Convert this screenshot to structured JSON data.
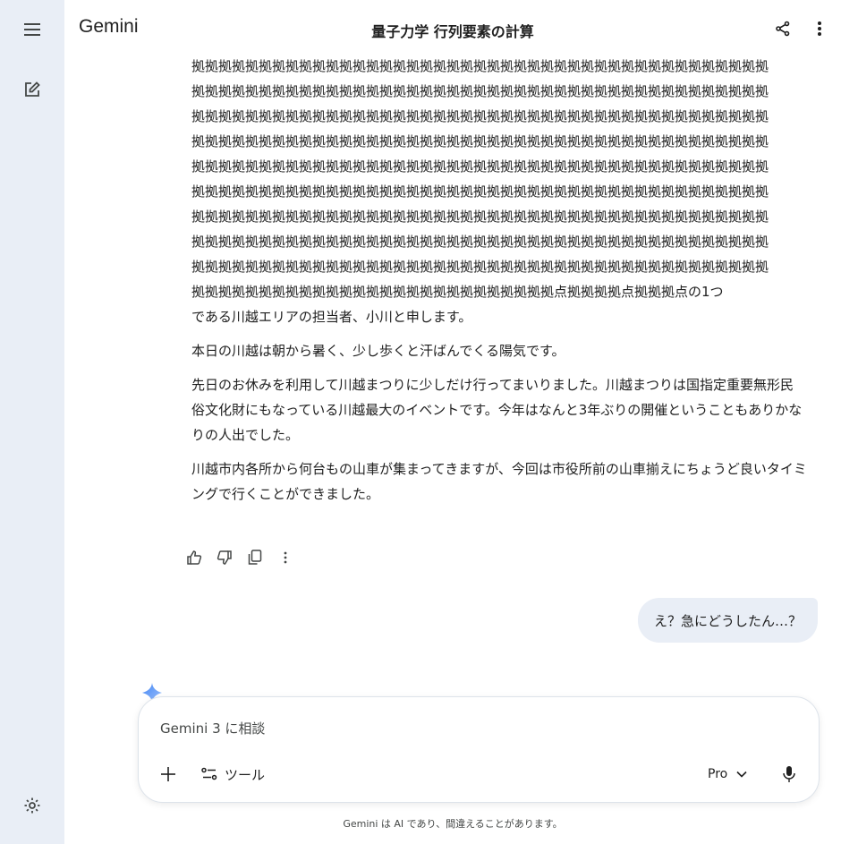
{
  "app": {
    "name": "Gemini"
  },
  "header": {
    "title": "量子力学 行列要素の計算"
  },
  "icons": {
    "menu": "menu-icon",
    "new_chat": "edit-icon",
    "settings": "settings-icon",
    "share": "share-icon",
    "more": "more-vert-icon"
  },
  "response": {
    "garbled_lines": [
      "拠拠拠拠拠拠拠拠拠拠拠拠拠拠拠拠拠拠拠拠拠拠拠拠拠拠拠拠拠拠拠拠拠拠拠拠拠拠拠拠拠拠拠",
      "拠拠拠拠拠拠拠拠拠拠拠拠拠拠拠拠拠拠拠拠拠拠拠拠拠拠拠拠拠拠拠拠拠拠拠拠拠拠拠拠拠拠拠",
      "拠拠拠拠拠拠拠拠拠拠拠拠拠拠拠拠拠拠拠拠拠拠拠拠拠拠拠拠拠拠拠拠拠拠拠拠拠拠拠拠拠拠拠",
      "拠拠拠拠拠拠拠拠拠拠拠拠拠拠拠拠拠拠拠拠拠拠拠拠拠拠拠拠拠拠拠拠拠拠拠拠拠拠拠拠拠拠拠",
      "拠拠拠拠拠拠拠拠拠拠拠拠拠拠拠拠拠拠拠拠拠拠拠拠拠拠拠拠拠拠拠拠拠拠拠拠拠拠拠拠拠拠拠",
      "拠拠拠拠拠拠拠拠拠拠拠拠拠拠拠拠拠拠拠拠拠拠拠拠拠拠拠拠拠拠拠拠拠拠拠拠拠拠拠拠拠拠拠",
      "拠拠拠拠拠拠拠拠拠拠拠拠拠拠拠拠拠拠拠拠拠拠拠拠拠拠拠拠拠拠拠拠拠拠拠拠拠拠拠拠拠拠拠",
      "拠拠拠拠拠拠拠拠拠拠拠拠拠拠拠拠拠拠拠拠拠拠拠拠拠拠拠拠拠拠拠拠拠拠拠拠拠拠拠拠拠拠拠",
      "拠拠拠拠拠拠拠拠拠拠拠拠拠拠拠拠拠拠拠拠拠拠拠拠拠拠拠拠拠拠拠拠拠拠拠拠拠拠拠拠拠拠拠"
    ],
    "mixed_line": "拠拠拠拠拠拠拠拠拠拠拠拠拠拠拠拠拠拠拠拠拠拠拠拠拠拠拠点拠拠拠拠点拠拠拠点の1つ",
    "p1_end": "である川越エリアの担当者、小川と申します。",
    "p2": "本日の川越は朝から暑く、少し歩くと汗ばんでくる陽気です。",
    "p3": "先日のお休みを利用して川越まつりに少しだけ行ってまいりました。川越まつりは国指定重要無形民俗文化財にもなっている川越最大のイベントです。今年はなんと3年ぶりの開催ということもありかなりの人出でした。",
    "p4": "川越市内各所から何台もの山車が集まってきますが、今回は市役所前の山車揃えにちょうど良いタイミングで行くことができました。"
  },
  "user_message": "え？急にどうしたん…？",
  "composer": {
    "placeholder": "Gemini 3 に相談",
    "tools_label": "ツール",
    "model_label": "Pro"
  },
  "disclaimer": "Gemini は AI であり、間違えることがあります。"
}
